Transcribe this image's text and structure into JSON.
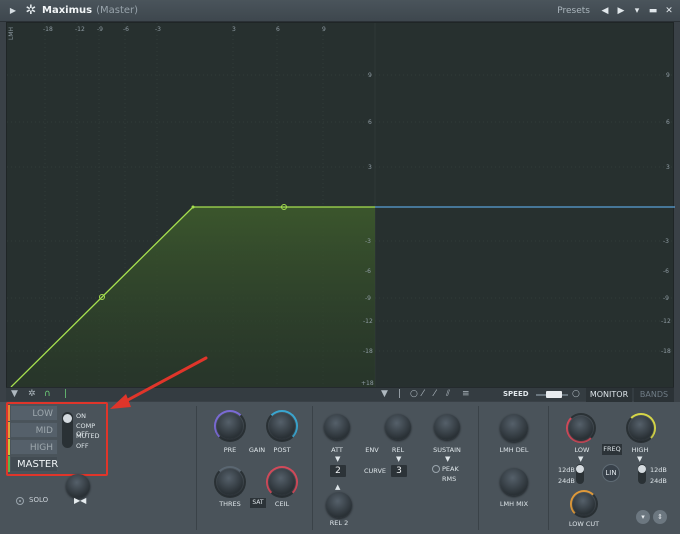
{
  "titlebar": {
    "title": "Maximus",
    "subtitle": "(Master)",
    "presets": "Presets"
  },
  "graph": {
    "left_label": "LMH",
    "top_scale": [
      "-18",
      "-12",
      "-9",
      "-6",
      "-3",
      "3",
      "6",
      "9"
    ],
    "right_scale": [
      "9",
      "6",
      "3",
      "-3",
      "-6",
      "-9",
      "-12",
      "-18"
    ],
    "mid_scale": [
      "9",
      "6",
      "3",
      "-3",
      "-6",
      "-9",
      "-12",
      "-18"
    ],
    "corner": "+18",
    "curve_color": "#a6e04f",
    "output_line_color": "#5a9fd6"
  },
  "toolbar": {
    "speed_label": "SPEED",
    "monitor_label": "MONITOR",
    "bands_label": "BANDS"
  },
  "bands": {
    "low": "LOW",
    "mid": "MID",
    "high": "HIGH",
    "master": "MASTER",
    "low_color": "#e08a3a",
    "mid_color": "#d8a33d",
    "high_color": "#c6c33e",
    "master_color": "#5db34a"
  },
  "mode": {
    "on": "ON",
    "comp_off": "COMP OFF",
    "muted": "MUTED",
    "off": "OFF"
  },
  "solo": "SOLO",
  "knobs": {
    "pre": "PRE",
    "gain": "GAIN",
    "post": "POST",
    "thres": "THRES",
    "sat": "SAT",
    "ceil": "CEIL",
    "att": "ATT",
    "env": "ENV",
    "rel": "REL",
    "sustain": "SUSTAIN",
    "curve": "CURVE",
    "curve_a": "2",
    "curve_b": "3",
    "peak": "PEAK",
    "rms": "RMS",
    "rel2": "REL 2",
    "lmh_del": "LMH DEL",
    "lmh_mix": "LMH MIX",
    "low": "LOW",
    "high": "HIGH",
    "freq": "FREQ",
    "lin": "LIN",
    "db12_left": "12dB",
    "db24_left": "24dB",
    "db12_right": "12dB",
    "db24_right": "24dB",
    "low_cut": "LOW CUT"
  },
  "annotation": {
    "color": "#e0352a"
  }
}
